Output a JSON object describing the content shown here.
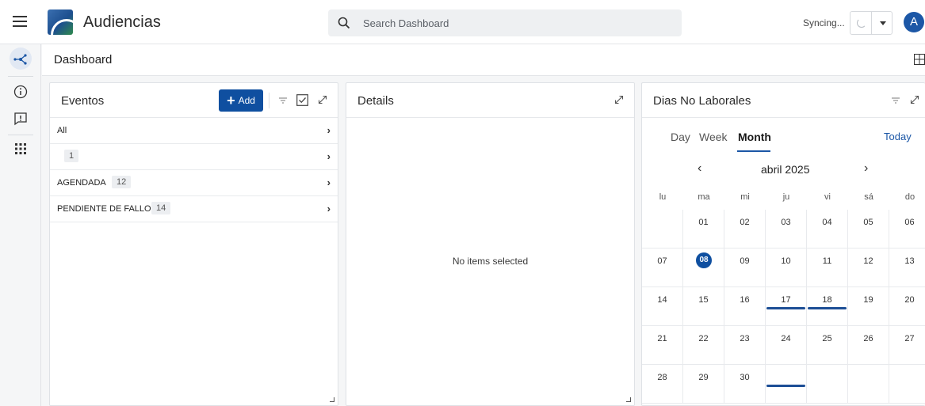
{
  "app": {
    "title": "Audiencias"
  },
  "search": {
    "placeholder": "Search Dashboard"
  },
  "status": {
    "sync_text": "Syncing..."
  },
  "user": {
    "avatar_letter": "A"
  },
  "subheader": {
    "title": "Dashboard"
  },
  "eventos": {
    "title": "Eventos",
    "add_label": "Add",
    "rows": [
      {
        "label": "All",
        "badge": ""
      },
      {
        "label": "",
        "badge": "1"
      },
      {
        "label": "AGENDADA",
        "badge": "12"
      },
      {
        "label": "PENDIENTE DE FALLO",
        "badge": "14"
      }
    ]
  },
  "details": {
    "title": "Details",
    "empty_text": "No items selected"
  },
  "calendar": {
    "title": "Dias No Laborales",
    "views": [
      "Day",
      "Week",
      "Month"
    ],
    "active_view": "Month",
    "today_label": "Today",
    "month_label": "abril 2025",
    "weekdays": [
      "lu",
      "ma",
      "mi",
      "ju",
      "vi",
      "sá",
      "do"
    ],
    "weeks": [
      [
        "",
        "01",
        "02",
        "03",
        "04",
        "05",
        "06"
      ],
      [
        "07",
        "08",
        "09",
        "10",
        "11",
        "12",
        "13"
      ],
      [
        "14",
        "15",
        "16",
        "17",
        "18",
        "19",
        "20"
      ],
      [
        "21",
        "22",
        "23",
        "24",
        "25",
        "26",
        "27"
      ],
      [
        "28",
        "29",
        "30",
        "",
        "",
        "",
        ""
      ]
    ],
    "selected_day": "08",
    "event_days": [
      "17",
      "18"
    ],
    "event_after_last_day": true,
    "accent_color": "#0f4fa0"
  }
}
